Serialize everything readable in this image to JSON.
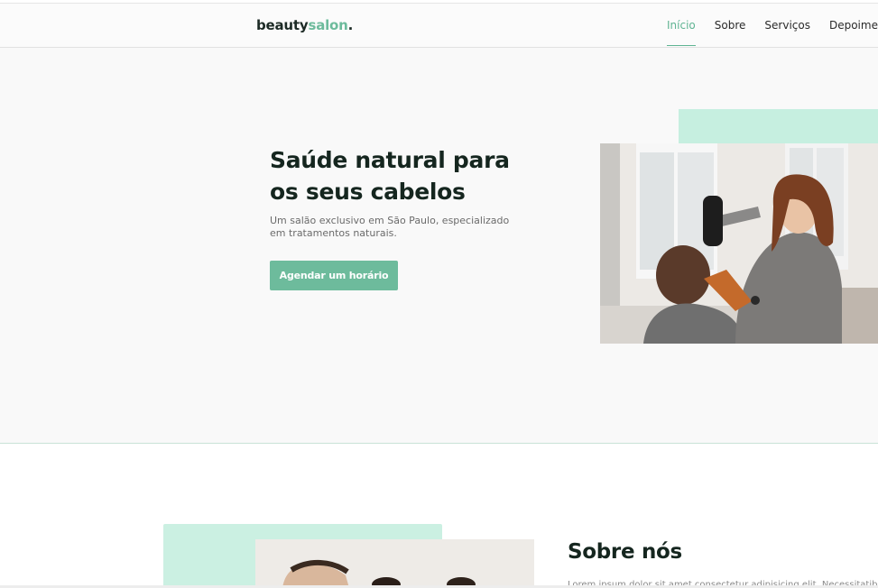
{
  "brand": {
    "part1": "beauty",
    "part2": "salon",
    "suffix": ".",
    "accent_color": "#6dbb9c"
  },
  "nav": {
    "items": [
      {
        "label": "Início",
        "active": true
      },
      {
        "label": "Sobre",
        "active": false
      },
      {
        "label": "Serviços",
        "active": false
      },
      {
        "label": "Depoimentos",
        "active": false
      }
    ]
  },
  "hero": {
    "title": "Saúde natural para os seus cabelos",
    "text": "Um salão exclusivo em São Paulo, especializado em tratamentos naturais.",
    "cta_label": "Agendar um horário"
  },
  "about": {
    "title": "Sobre nós",
    "text": "Lorem ipsum dolor sit amet consectetur adipisicing elit. Necessitatib"
  }
}
